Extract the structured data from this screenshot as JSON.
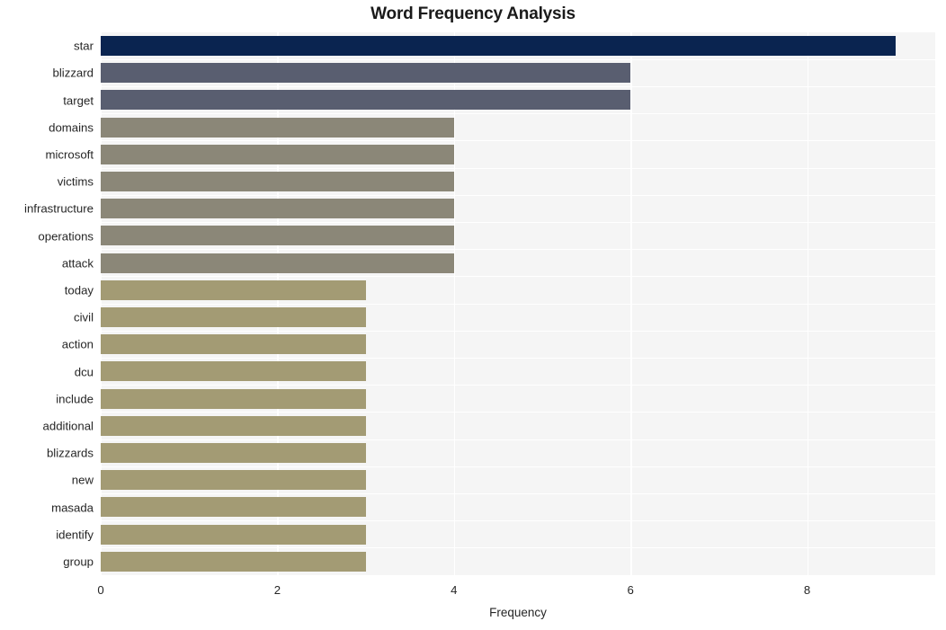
{
  "chart_data": {
    "type": "bar",
    "orientation": "horizontal",
    "title": "Word Frequency Analysis",
    "xlabel": "Frequency",
    "ylabel": "",
    "xlim": [
      0,
      9.45
    ],
    "xticks": [
      0,
      2,
      4,
      6,
      8
    ],
    "xtick_labels": [
      "0",
      "2",
      "4",
      "6",
      "8"
    ],
    "grid": true,
    "legend": "none",
    "categories": [
      "star",
      "blizzard",
      "target",
      "domains",
      "microsoft",
      "victims",
      "infrastructure",
      "operations",
      "attack",
      "today",
      "civil",
      "action",
      "dcu",
      "include",
      "additional",
      "blizzards",
      "new",
      "masada",
      "identify",
      "group"
    ],
    "values": [
      9,
      6,
      6,
      4,
      4,
      4,
      4,
      4,
      4,
      3,
      3,
      3,
      3,
      3,
      3,
      3,
      3,
      3,
      3,
      3
    ],
    "bar_colors": [
      "#0a2450",
      "#595e70",
      "#595e70",
      "#8b8778",
      "#8b8778",
      "#8b8778",
      "#8b8778",
      "#8b8778",
      "#8b8778",
      "#a39b74",
      "#a39b74",
      "#a39b74",
      "#a39b74",
      "#a39b74",
      "#a39b74",
      "#a39b74",
      "#a39b74",
      "#a39b74",
      "#a39b74",
      "#a39b74"
    ],
    "plot_background": "#f5f5f5",
    "gridline_color": "#ffffff",
    "figure_background": "#ffffff"
  }
}
